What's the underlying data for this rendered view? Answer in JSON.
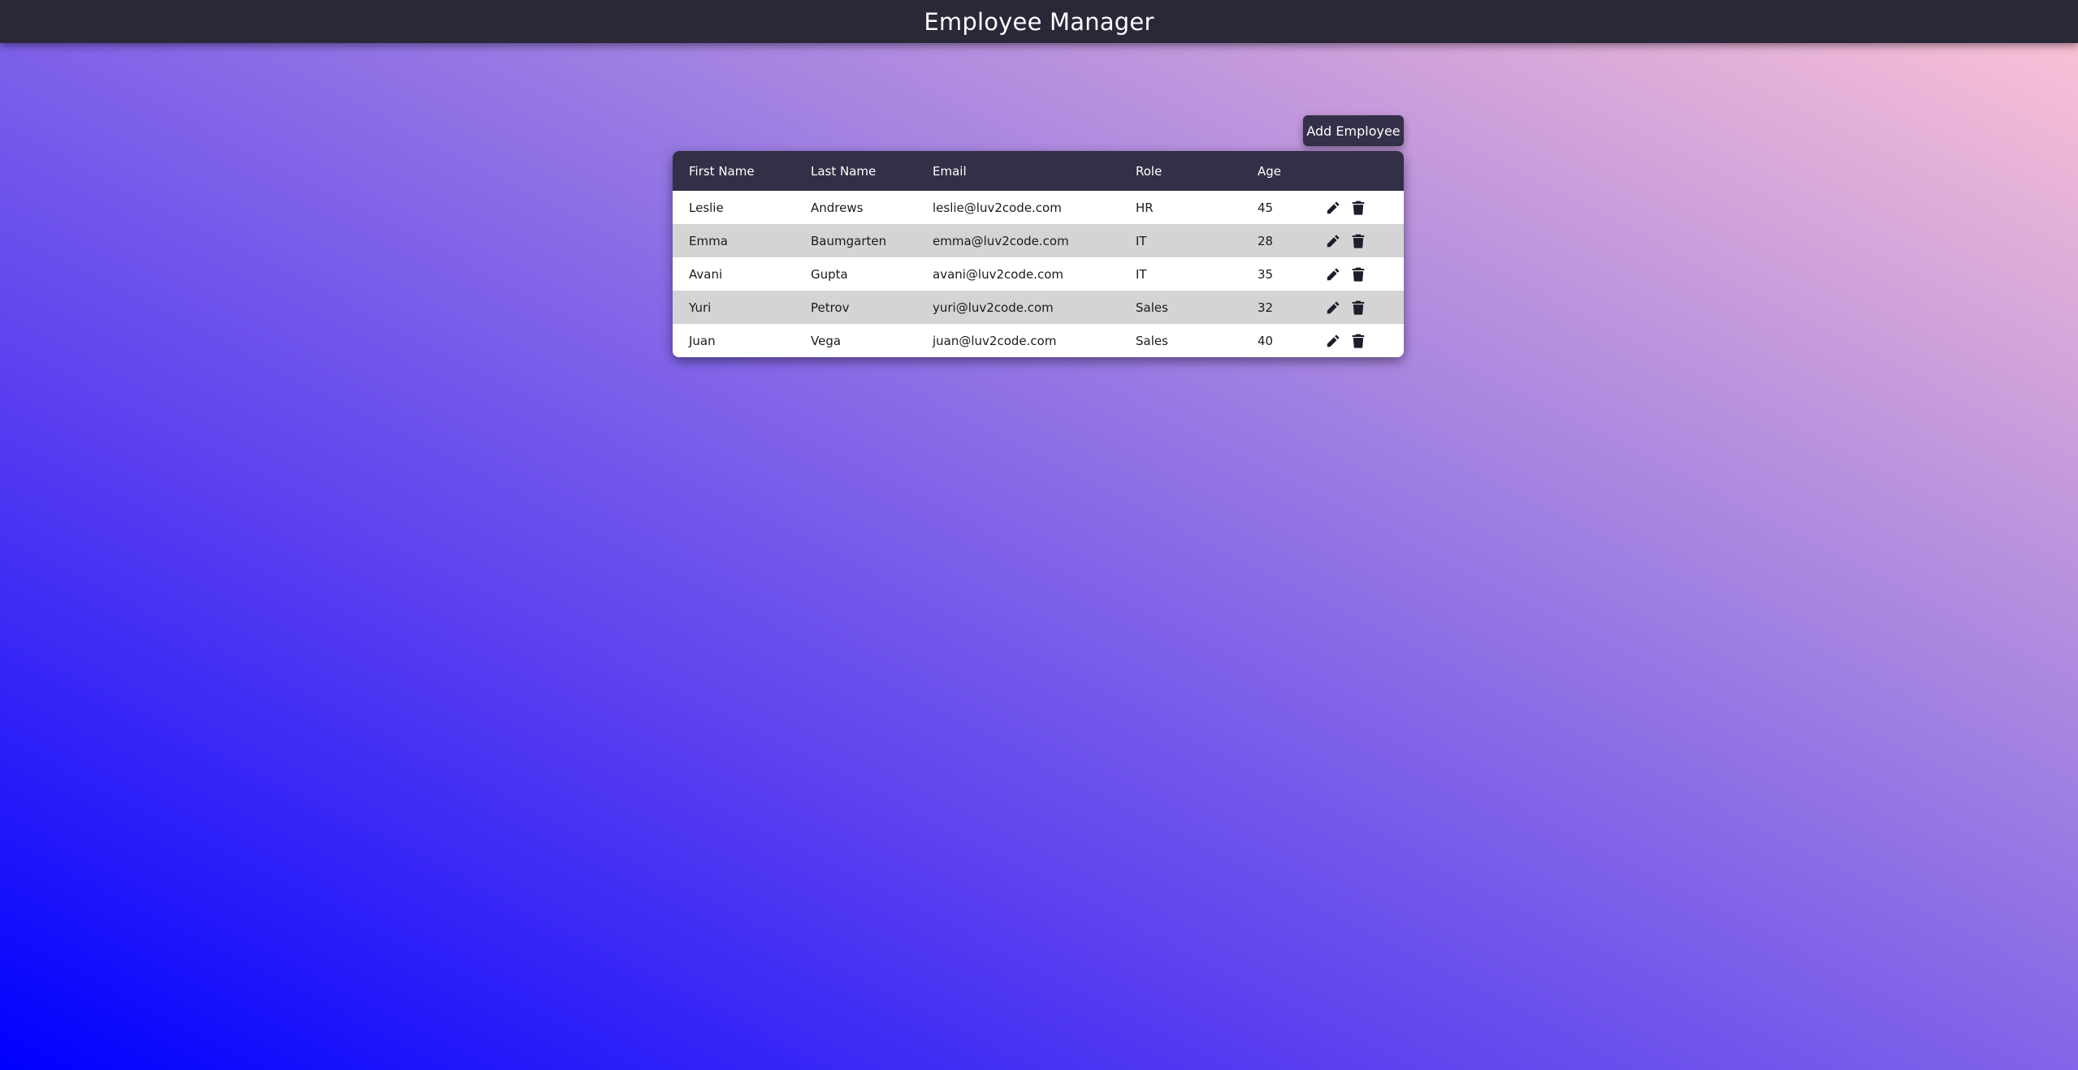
{
  "header": {
    "title": "Employee Manager"
  },
  "toolbar": {
    "add_label": "Add Employee"
  },
  "table": {
    "columns": [
      "First Name",
      "Last Name",
      "Email",
      "Role",
      "Age",
      ""
    ],
    "rows": [
      {
        "first": "Leslie",
        "last": "Andrews",
        "email": "leslie@luv2code.com",
        "role": "HR",
        "age": "45"
      },
      {
        "first": "Emma",
        "last": "Baumgarten",
        "email": "emma@luv2code.com",
        "role": "IT",
        "age": "28"
      },
      {
        "first": "Avani",
        "last": "Gupta",
        "email": "avani@luv2code.com",
        "role": "IT",
        "age": "35"
      },
      {
        "first": "Yuri",
        "last": "Petrov",
        "email": "yuri@luv2code.com",
        "role": "Sales",
        "age": "32"
      },
      {
        "first": "Juan",
        "last": "Vega",
        "email": "juan@luv2code.com",
        "role": "Sales",
        "age": "40"
      }
    ],
    "row_icons": [
      "pencil-icon",
      "trash-icon"
    ]
  },
  "colors": {
    "header_bg": "#2a2838",
    "table_header_bg": "#322f47",
    "row_alt_bg": "#d4d4d4",
    "gradient_start": "#0000ff",
    "gradient_end": "#ffc4d4"
  }
}
